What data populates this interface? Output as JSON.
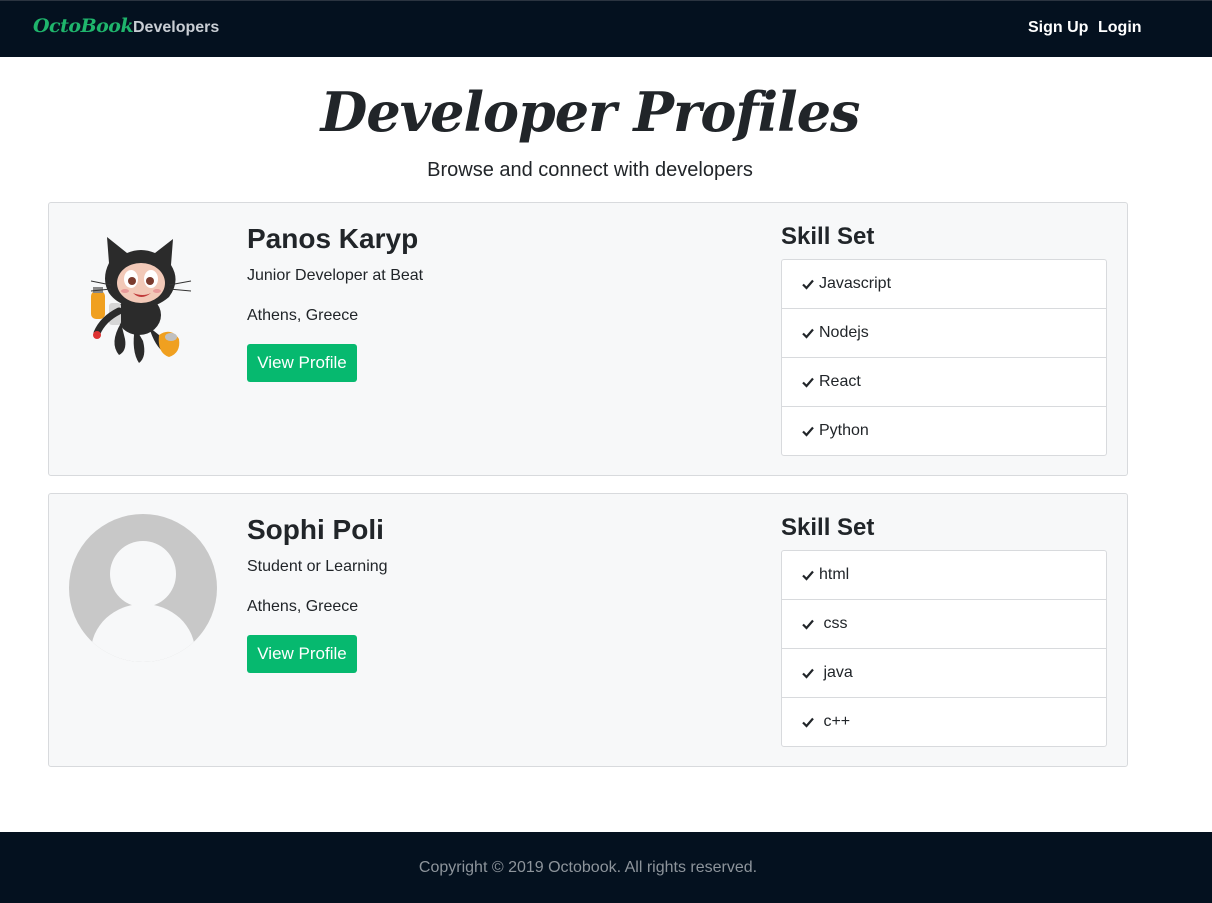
{
  "navbar": {
    "brand": "OctoBook",
    "developers": "Developers",
    "sign_up": "Sign Up",
    "login": "Login"
  },
  "header": {
    "title": "Developer Profiles",
    "subtitle": "Browse and connect with developers"
  },
  "profiles": [
    {
      "name": "Panos Karyp",
      "role": "Junior Developer at Beat",
      "location": "Athens, Greece",
      "button": "View Profile",
      "skills_heading": "Skill Set",
      "avatar_icon": "octocat-avatar-icon",
      "skills": [
        "Javascript",
        "Nodejs",
        "React",
        "Python"
      ]
    },
    {
      "name": "Sophi Poli",
      "role": "Student or Learning",
      "location": "Athens, Greece",
      "button": "View Profile",
      "skills_heading": "Skill Set",
      "avatar_icon": "default-user-avatar-icon",
      "skills": [
        "html",
        " css",
        " java",
        " c++"
      ]
    }
  ],
  "footer": {
    "copyright": "Copyright © 2019 Octobook. All rights reserved."
  },
  "colors": {
    "navbar_bg": "#04111f",
    "brand": "#1fb56c",
    "button": "#06b96f",
    "card_bg": "#f7f8f9"
  }
}
